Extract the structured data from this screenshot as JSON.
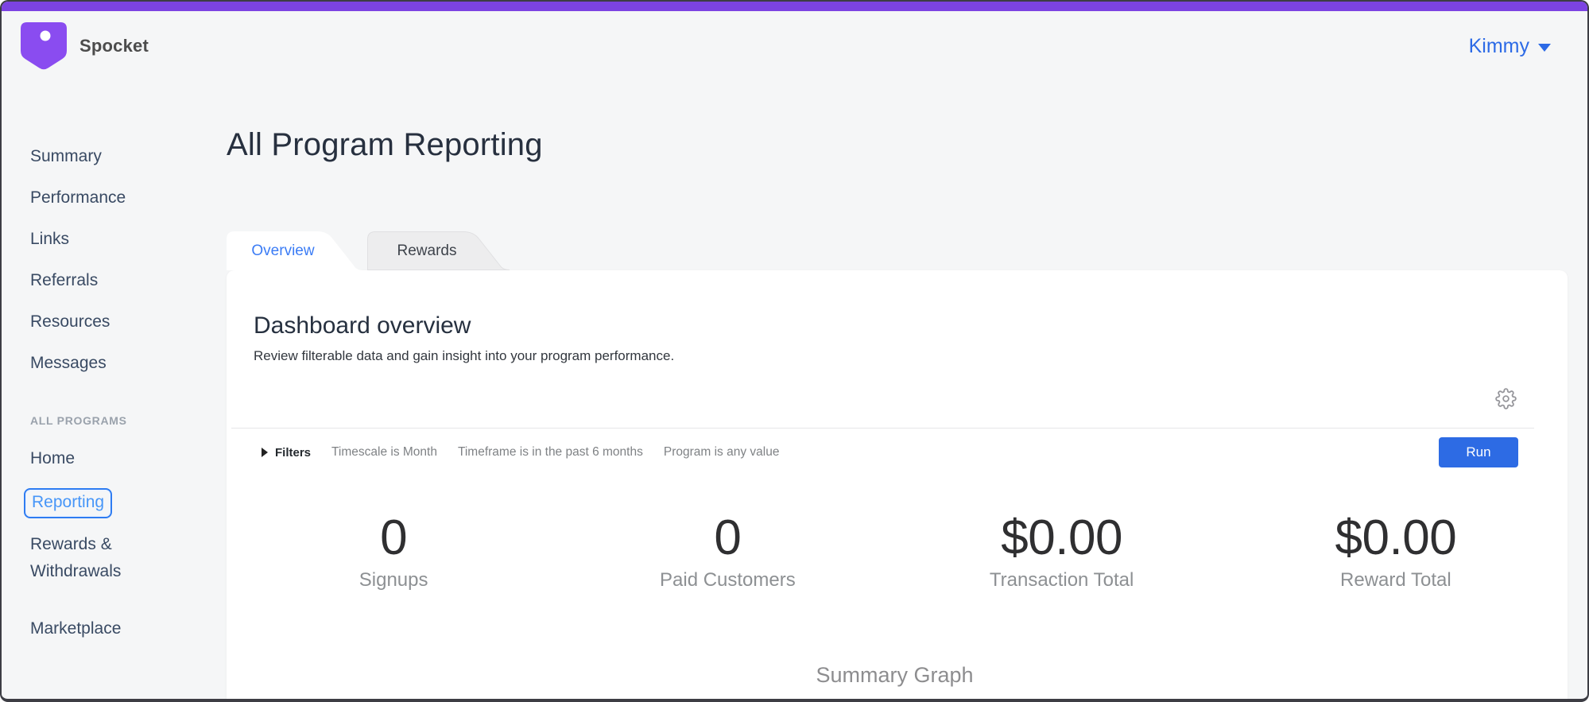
{
  "header": {
    "brand": "Spocket",
    "user": "Kimmy"
  },
  "sidebar": {
    "items": [
      "Summary",
      "Performance",
      "Links",
      "Referrals",
      "Resources",
      "Messages"
    ],
    "section_label": "ALL PROGRAMS",
    "program_items": [
      {
        "label": "Home",
        "active": false
      },
      {
        "label": "Reporting",
        "active": true
      },
      {
        "label": "Rewards & Withdrawals",
        "active": false
      },
      {
        "label": "Marketplace",
        "active": false
      }
    ]
  },
  "main": {
    "title": "All Program Reporting",
    "tabs": [
      {
        "label": "Overview",
        "active": true
      },
      {
        "label": "Rewards",
        "active": false
      }
    ],
    "dashboard": {
      "heading": "Dashboard overview",
      "subheading": "Review filterable data and gain insight into your program performance.",
      "filters": {
        "label": "Filters",
        "summary": [
          "Timescale is Month",
          "Timeframe is in the past 6 months",
          "Program is any value"
        ],
        "run_label": "Run"
      },
      "stats": [
        {
          "value": "0",
          "label": "Signups"
        },
        {
          "value": "0",
          "label": "Paid Customers"
        },
        {
          "value": "$0.00",
          "label": "Transaction Total"
        },
        {
          "value": "$0.00",
          "label": "Reward Total"
        }
      ],
      "graph_title": "Summary Graph"
    }
  },
  "colors": {
    "accent_purple": "#7c43e2",
    "brand_purple": "#8a4cf0",
    "link_blue": "#2c6ae6",
    "tab_active_blue": "#3b7cf5",
    "nav_active_blue": "#4796f8",
    "run_button_blue": "#2d6be4",
    "page_background": "#f5f6f7"
  }
}
